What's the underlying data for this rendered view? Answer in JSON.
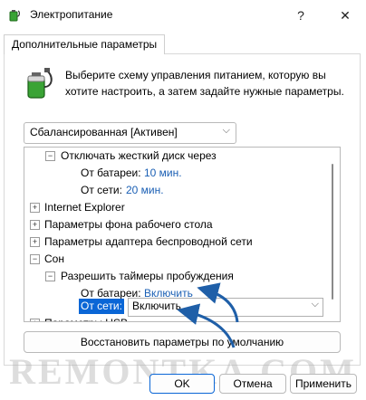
{
  "window": {
    "title": "Электропитание",
    "help_glyph": "?",
    "close_glyph": "✕"
  },
  "tab": {
    "label": "Дополнительные параметры"
  },
  "description": "Выберите схему управления питанием, которую вы хотите настроить, а затем задайте нужные параметры.",
  "plan_select": {
    "value": "Сбалансированная [Активен]"
  },
  "tree": {
    "disk": {
      "label": "Отключать жесткий диск через",
      "battery_label": "От батареи:",
      "battery_value": "10 мин.",
      "ac_label": "От сети:",
      "ac_value": "20 мин."
    },
    "items": [
      {
        "label": "Internet Explorer"
      },
      {
        "label": "Параметры фона рабочего стола"
      },
      {
        "label": "Параметры адаптера беспроводной сети"
      },
      {
        "label": "Сон"
      }
    ],
    "wake_timers": {
      "label": "Разрешить таймеры пробуждения",
      "battery_label": "От батареи:",
      "battery_value": "Включить",
      "ac_label": "От сети:",
      "ac_value": "Включить"
    },
    "usb_label": "Параметры USB"
  },
  "buttons": {
    "restore": "Восстановить параметры по умолчанию",
    "ok": "OK",
    "cancel": "Отмена",
    "apply": "Применить"
  },
  "watermark": "REMONTKA.COM",
  "colors": {
    "link_value": "#1a5fb4",
    "selection": "#0a66d6",
    "annotation_arrow": "#1f5fa8"
  },
  "icons": {
    "app": "battery-plug-icon",
    "expand": "plus-box-icon",
    "collapse": "minus-box-icon"
  }
}
